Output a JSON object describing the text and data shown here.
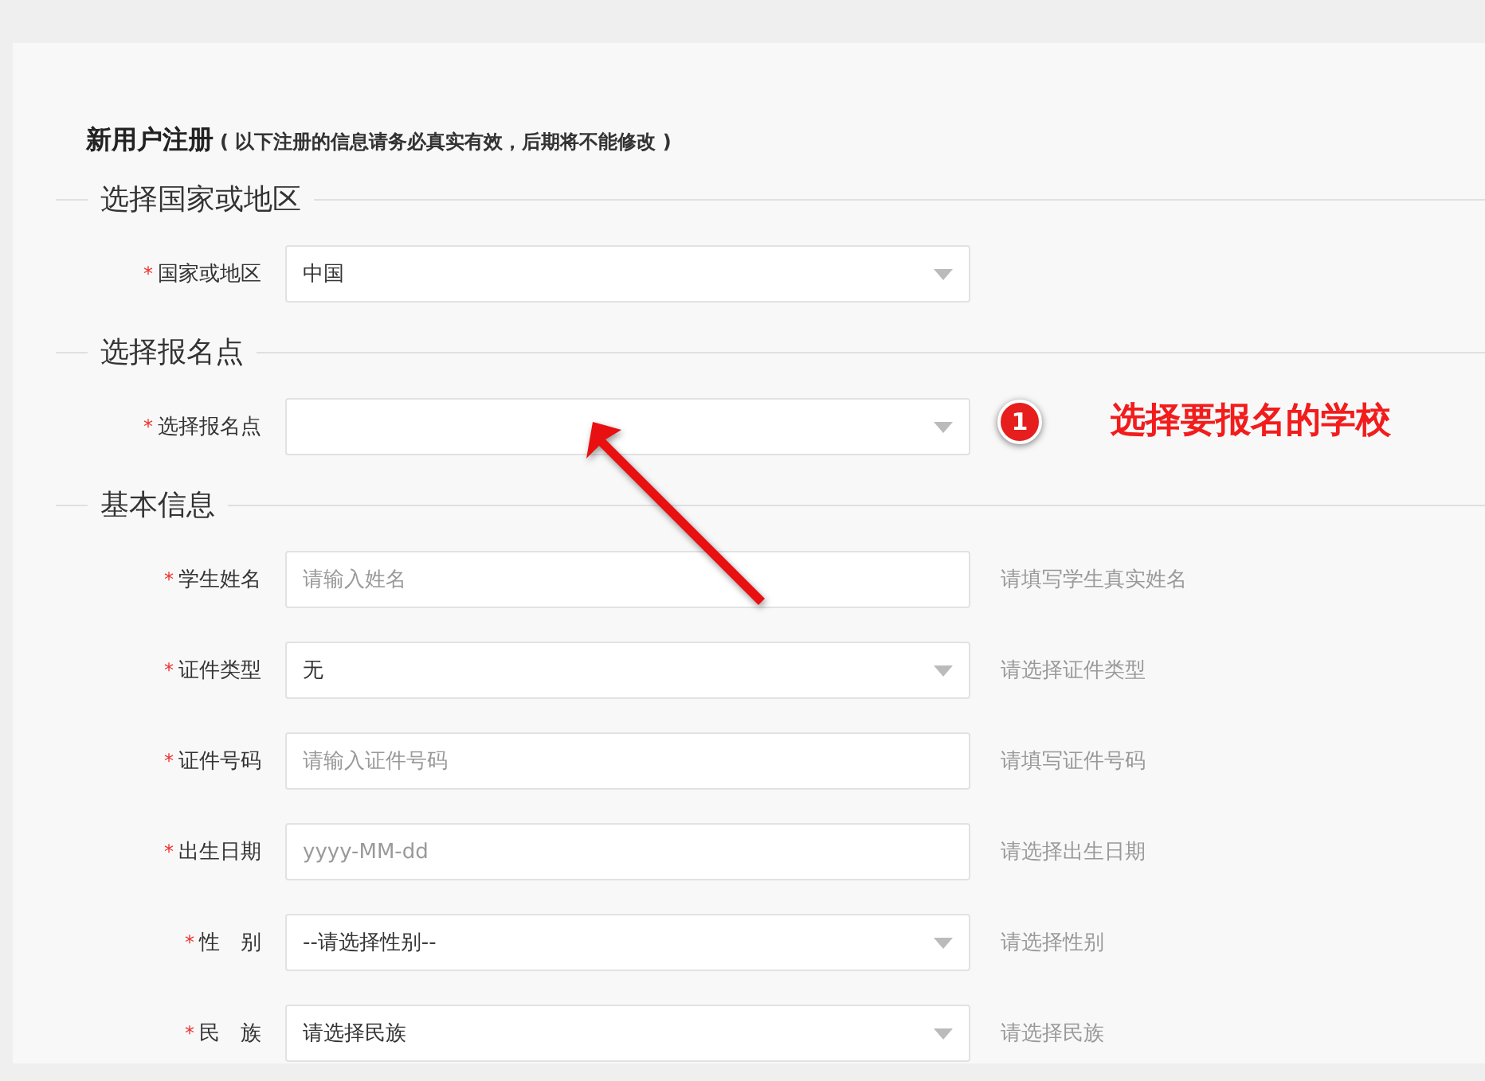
{
  "form": {
    "title": "新用户注册",
    "note": "( 以下注册的信息请务必真实有效，后期将不能修改 )"
  },
  "required_mark": "*",
  "sections": [
    {
      "title": "选择国家或地区",
      "fields": [
        {
          "label": "国家或地区",
          "kind": "select",
          "required": true,
          "value": "中国"
        }
      ]
    },
    {
      "title": "选择报名点",
      "fields": [
        {
          "label": "选择报名点",
          "kind": "select",
          "required": true
        }
      ]
    },
    {
      "title": "基本信息",
      "fields": [
        {
          "label": "学生姓名",
          "kind": "text",
          "required": true,
          "placeholder": "请输入姓名",
          "hint": "请填写学生真实姓名"
        },
        {
          "label": "证件类型",
          "kind": "select",
          "required": true,
          "value": "无",
          "hint": "请选择证件类型"
        },
        {
          "label": "证件号码",
          "kind": "text",
          "required": true,
          "placeholder": "请输入证件号码",
          "hint": "请填写证件号码"
        },
        {
          "label": "出生日期",
          "kind": "text",
          "required": true,
          "placeholder": "yyyy-MM-dd",
          "hint": "请选择出生日期"
        },
        {
          "label": "性　别",
          "kind": "select",
          "required": true,
          "value": "--请选择性别--",
          "hint": "请选择性别"
        },
        {
          "label": "民　族",
          "kind": "select",
          "required": true,
          "value": "请选择民族",
          "hint": "请选择民族"
        }
      ]
    }
  ],
  "annotation": {
    "number": "1",
    "text": "选择要报名的学校"
  }
}
